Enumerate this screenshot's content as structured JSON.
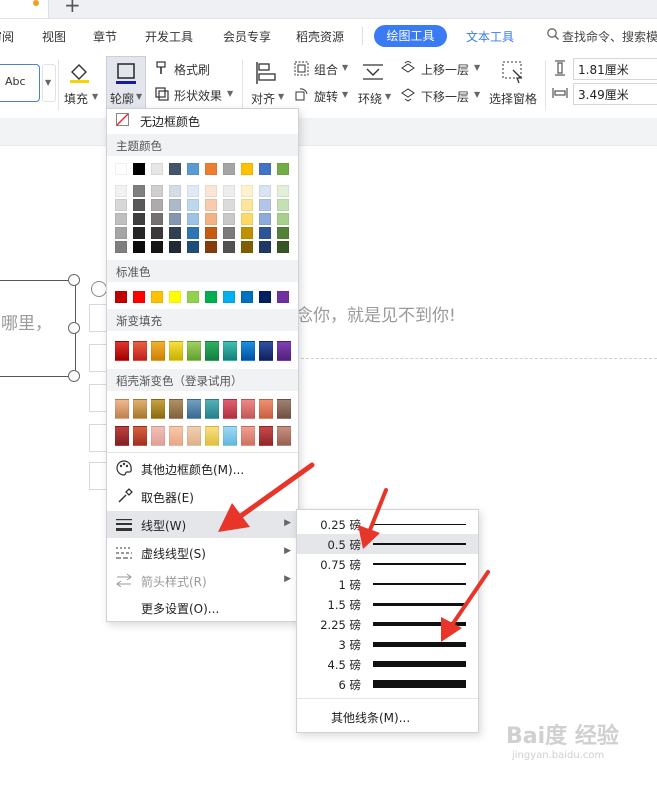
{
  "menubar": {
    "items": [
      "审阅",
      "视图",
      "章节",
      "开发工具",
      "会员专享",
      "稻壳资源"
    ],
    "active_tab": "绘图工具",
    "text_tab": "文本工具",
    "search_placeholder": "查找命令、搜索模"
  },
  "ribbon": {
    "style_sample": "Abc",
    "fill": "填充",
    "outline": "轮廓",
    "format_painter": "格式刷",
    "shape_effects": "形状效果",
    "align": "对齐",
    "group": "组合",
    "rotate": "旋转",
    "wrap": "环绕",
    "move_up": "上移一层",
    "move_down": "下移一层",
    "selection_pane": "选择窗格",
    "height_value": "1.81厘米",
    "width_value": "3.49厘米"
  },
  "document": {
    "left_text": "哪里，",
    "right_text": "念你，就是见不到你!"
  },
  "dropdown": {
    "no_border": "无边框颜色",
    "theme_colors_label": "主题颜色",
    "standard_colors_label": "标准色",
    "gradient_fill_label": "渐变填充",
    "docer_gradient_label": "稻壳渐变色（登录试用）",
    "more_colors": "其他边框颜色(M)...",
    "color_picker": "取色器(E)",
    "line_style": "线型(W)",
    "dash_style": "虚线线型(S)",
    "arrow_style": "箭头样式(R)",
    "more_settings": "更多设置(O)...",
    "theme_colors": [
      "#ffffff",
      "#000000",
      "#e7e6e6",
      "#44546a",
      "#5b9bd5",
      "#ed7d31",
      "#a5a5a5",
      "#ffc000",
      "#4472c4",
      "#70ad47"
    ],
    "theme_shades": [
      [
        "#f2f2f2",
        "#7f7f7f",
        "#d0cece",
        "#d6dce4",
        "#deebf6",
        "#fbe5d5",
        "#ededed",
        "#fff2cc",
        "#dae3f3",
        "#e2efd9"
      ],
      [
        "#d8d8d8",
        "#595959",
        "#aeabab",
        "#adb9ca",
        "#bdd7ee",
        "#f7cbac",
        "#dbdbdb",
        "#fee599",
        "#b4c6e7",
        "#c5e0b3"
      ],
      [
        "#bfbfbf",
        "#3f3f3f",
        "#757070",
        "#8496b0",
        "#9cc3e5",
        "#f4b183",
        "#c9c9c9",
        "#ffd965",
        "#8eaadb",
        "#a8d08d"
      ],
      [
        "#a5a5a5",
        "#262626",
        "#3a3838",
        "#323f4f",
        "#2e75b5",
        "#c55a11",
        "#7b7b7b",
        "#bf9000",
        "#2f5496",
        "#538135"
      ],
      [
        "#7f7f7f",
        "#0c0c0c",
        "#171616",
        "#222a35",
        "#1e4e79",
        "#843c0b",
        "#525252",
        "#7f6000",
        "#1f3864",
        "#375623"
      ]
    ],
    "standard_colors": [
      "#c00000",
      "#ff0000",
      "#ffc000",
      "#ffff00",
      "#92d050",
      "#00b050",
      "#00b0f0",
      "#0070c0",
      "#002060",
      "#7030a0"
    ],
    "gradient_colors": [
      [
        "#e0342c",
        "#a00000"
      ],
      [
        "#e86040",
        "#c02020"
      ],
      [
        "#f0b030",
        "#d08000"
      ],
      [
        "#f4e040",
        "#c8b000"
      ],
      [
        "#a0d060",
        "#60a030"
      ],
      [
        "#30b060",
        "#108040"
      ],
      [
        "#40c0b0",
        "#10807a"
      ],
      [
        "#2090e0",
        "#0050a0"
      ],
      [
        "#3050a0",
        "#102060"
      ],
      [
        "#8040b0",
        "#502080"
      ]
    ],
    "docer_row1": [
      [
        "#f0b890",
        "#c08050"
      ],
      [
        "#e0b070",
        "#a87830"
      ],
      [
        "#c8a040",
        "#8a6a10"
      ],
      [
        "#b09060",
        "#806040"
      ],
      [
        "#70a0c0",
        "#3a6890"
      ],
      [
        "#50b0b8",
        "#2a8088"
      ],
      [
        "#e06070",
        "#b03040"
      ],
      [
        "#f08888",
        "#c05858"
      ],
      [
        "#f09070",
        "#c86040"
      ],
      [
        "#a08070",
        "#705040"
      ]
    ],
    "docer_row2": [
      [
        "#c04040",
        "#802020"
      ],
      [
        "#d86040",
        "#a03020"
      ],
      [
        "#f0c0b8",
        "#e0a098"
      ],
      [
        "#f8c8a8",
        "#e8a888"
      ],
      [
        "#f0d0b0",
        "#e0b088"
      ],
      [
        "#f8e080",
        "#e0c040"
      ],
      [
        "#a0d8f0",
        "#60b8e0"
      ],
      [
        "#f0a090",
        "#d07060"
      ],
      [
        "#c84848",
        "#902828"
      ],
      [
        "#c89080",
        "#986050"
      ]
    ]
  },
  "submenu": {
    "weights": [
      "0.25 磅",
      "0.5 磅",
      "0.75 磅",
      "1 磅",
      "1.5 磅",
      "2.25 磅",
      "3 磅",
      "4.5 磅",
      "6 磅"
    ],
    "selected_index": 1,
    "other_lines": "其他线条(M)..."
  },
  "watermark": {
    "text": "Bai度 经验",
    "url": "jingyan.baidu.com"
  },
  "colors": {
    "accent": "#3a7bf5",
    "annotation_arrow": "#e8352a"
  }
}
